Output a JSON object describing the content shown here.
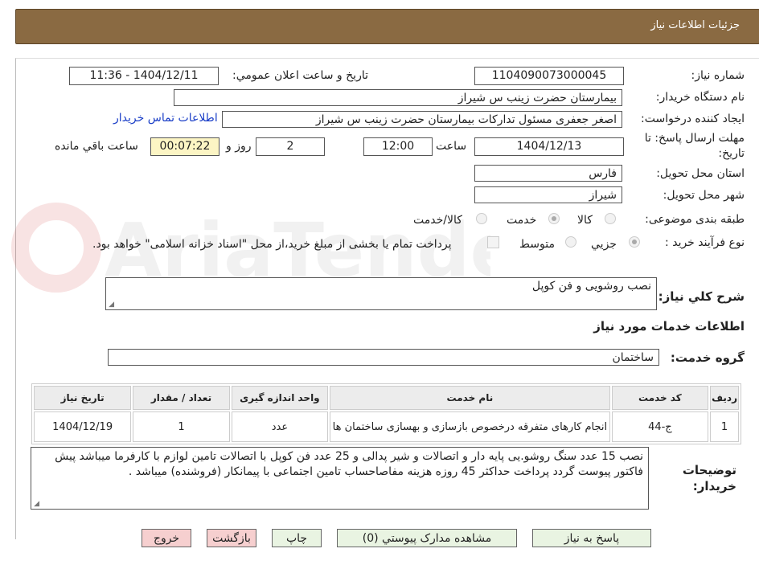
{
  "header": {
    "title": "جزئیات اطلاعات نیاز"
  },
  "fields": {
    "need_number_label": "شماره نیاز:",
    "need_number": "1104090073000045",
    "announce_label": "تاریخ و ساعت اعلان عمومي:",
    "announce_value": "1404/12/11 - 11:36",
    "buyer_org_label": "نام دستگاه خریدار:",
    "buyer_org": "بیمارستان حضرت زینب  س  شیراز",
    "requester_label": "ایجاد کننده درخواست:",
    "requester": "اصغر جعفری مسئول تدارکات بیمارستان حضرت زینب  س  شیراز",
    "contact_link": "اطلاعات تماس خریدار",
    "deadline_label": "مهلت ارسال پاسخ: تا تاریخ:",
    "deadline_date": "1404/12/13",
    "time_label": "ساعت",
    "deadline_time": "12:00",
    "days_value": "2",
    "days_label": "روز و",
    "remaining_time": "00:07:22",
    "remaining_label": "ساعت باقي مانده",
    "province_label": "استان محل تحویل:",
    "province": "فارس",
    "city_label": "شهر محل تحویل:",
    "city": "شیراز",
    "category_label": "طبقه بندی موضوعی:",
    "category_options": [
      "کالا",
      "خدمت",
      "کالا/خدمت"
    ],
    "category_selected": "خدمت",
    "process_label": "نوع فرآیند خرید :",
    "process_options": [
      "جزيي",
      "متوسط"
    ],
    "process_selected": "جزيي",
    "payment_note": "پرداخت تمام یا بخشی از مبلغ خرید،از محل \"اسناد خزانه اسلامی\" خواهد بود."
  },
  "summary": {
    "label": "شرح کلي نیاز:",
    "value": "نصب روشویی و فن کوپل"
  },
  "services_heading": "اطلاعات خدمات مورد نیاز",
  "service_group": {
    "label": "گروه خدمت:",
    "value": "ساختمان"
  },
  "table": {
    "headers": [
      "ردیف",
      "کد خدمت",
      "نام خدمت",
      "واحد اندازه گیری",
      "تعداد / مقدار",
      "تاریخ نیاز"
    ],
    "rows": [
      [
        "1",
        "ج-44",
        "انجام کارهای متفرقه درخصوص بازسازی و بهسازی ساختمان ها",
        "عدد",
        "1",
        "1404/12/19"
      ]
    ]
  },
  "buyer_notes": {
    "label": "توضیحات خریدار:",
    "value": "نصب 15 عدد سنگ روشو.یی پایه دار و اتصالات و شیر پدالی   و 25 عدد فن کوپل با اتصالات   تامین لوازم با کارفرما میباشد  پیش فاکتور پیوست گردد   پرداخت  حداکثر 45 روزه      هزینه مفاصاحساب تامین اجتماعی با پیمانکار (فروشنده) میباشد ."
  },
  "buttons": {
    "reply": "پاسخ به نیاز",
    "attachments": "مشاهده مدارک پیوستي (0)",
    "print": "چاپ",
    "back": "بازگشت",
    "exit": "خروج"
  },
  "watermark": "AriaTender.neT",
  "colors": {
    "header_bg": "#8a6a42",
    "link": "#1a3ec7",
    "time_bg": "#fcf5c4",
    "btn_green": "#e9f4e2",
    "btn_red": "#f6cfcf"
  }
}
